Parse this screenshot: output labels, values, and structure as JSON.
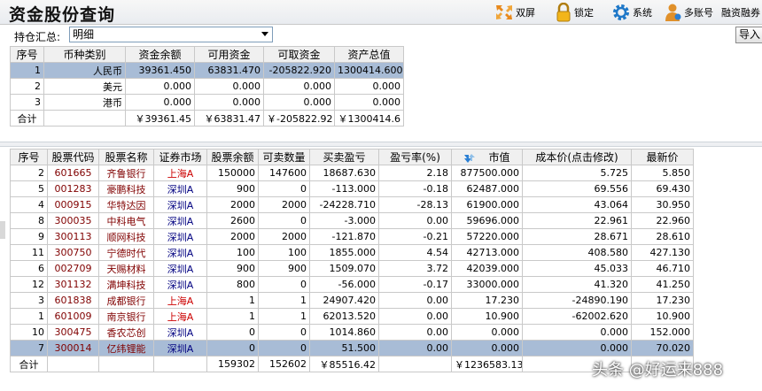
{
  "window": {
    "title": "资金股份查询"
  },
  "toolbar": {
    "dual_screen": "双屏",
    "lock": "锁定",
    "system": "系统",
    "multi_account": "多账号",
    "margin": "融资融券"
  },
  "filter": {
    "label": "持仓汇总:",
    "value": "明细",
    "import_label": "导入"
  },
  "funds": {
    "headers": [
      "序号",
      "币种类别",
      "资金余额",
      "可用资金",
      "可取资金",
      "资产总值"
    ],
    "rows": [
      [
        "1",
        "人民币",
        "39361.450",
        "63831.470",
        "-205822.920",
        "1300414.600"
      ],
      [
        "2",
        "美元",
        "0.000",
        "0.000",
        "0.000",
        "0.000"
      ],
      [
        "3",
        "港币",
        "0.000",
        "0.000",
        "0.000",
        "0.000"
      ]
    ],
    "total": [
      "合计",
      "",
      "￥39361.45",
      "￥63831.47",
      "￥-205822.92",
      "￥1300414.6"
    ]
  },
  "stocks": {
    "headers": [
      "序号",
      "股票代码",
      "股票名称",
      "证券市场",
      "股票余额",
      "可卖数量",
      "买卖盈亏",
      "盈亏率(%)",
      "市值",
      "成本价(点击修改)",
      "最新价"
    ],
    "rows": [
      [
        "2",
        "601665",
        "齐鲁银行",
        "上海A",
        "150000",
        "147600",
        "18687.630",
        "2.18",
        "877500.000",
        "5.725",
        "5.850"
      ],
      [
        "5",
        "001283",
        "豪鹏科技",
        "深圳A",
        "900",
        "0",
        "-113.000",
        "-0.18",
        "62487.000",
        "69.556",
        "69.430"
      ],
      [
        "4",
        "000915",
        "华特达因",
        "深圳A",
        "2000",
        "2000",
        "-24228.710",
        "-28.13",
        "61900.000",
        "43.064",
        "30.950"
      ],
      [
        "8",
        "300035",
        "中科电气",
        "深圳A",
        "2600",
        "0",
        "-3.000",
        "0.00",
        "59696.000",
        "22.961",
        "22.960"
      ],
      [
        "9",
        "300113",
        "顺网科技",
        "深圳A",
        "2000",
        "2000",
        "-121.870",
        "-0.21",
        "57220.000",
        "28.671",
        "28.610"
      ],
      [
        "11",
        "300750",
        "宁德时代",
        "深圳A",
        "100",
        "100",
        "1855.000",
        "4.54",
        "42713.000",
        "408.580",
        "427.130"
      ],
      [
        "6",
        "002709",
        "天赐材料",
        "深圳A",
        "900",
        "900",
        "1509.070",
        "3.72",
        "42039.000",
        "45.033",
        "46.710"
      ],
      [
        "12",
        "301132",
        "满坤科技",
        "深圳A",
        "800",
        "0",
        "-56.000",
        "-0.17",
        "33000.000",
        "41.320",
        "41.250"
      ],
      [
        "3",
        "601838",
        "成都银行",
        "上海A",
        "1",
        "1",
        "24907.420",
        "0.00",
        "17.230",
        "-24890.190",
        "17.230"
      ],
      [
        "1",
        "601009",
        "南京银行",
        "上海A",
        "1",
        "1",
        "62013.520",
        "0.00",
        "10.900",
        "-62002.620",
        "10.900"
      ],
      [
        "10",
        "300475",
        "香农芯创",
        "深圳A",
        "0",
        "0",
        "1014.860",
        "0.00",
        "0.000",
        "0.000",
        "152.000"
      ],
      [
        "7",
        "300014",
        "亿纬锂能",
        "深圳A",
        "0",
        "0",
        "51.500",
        "0.00",
        "0.000",
        "0.000",
        "70.020"
      ]
    ],
    "total": [
      "合计",
      "",
      "",
      "",
      "159302",
      "152602",
      "￥85516.42",
      "",
      "￥1236583.13",
      "",
      ""
    ]
  },
  "watermark": "头条 @好运来888",
  "colors": {
    "selected_row": "#a8bcd6",
    "name_text": "#800000",
    "shanghai_text": "#cc0000",
    "shenzhen_text": "#000080"
  }
}
